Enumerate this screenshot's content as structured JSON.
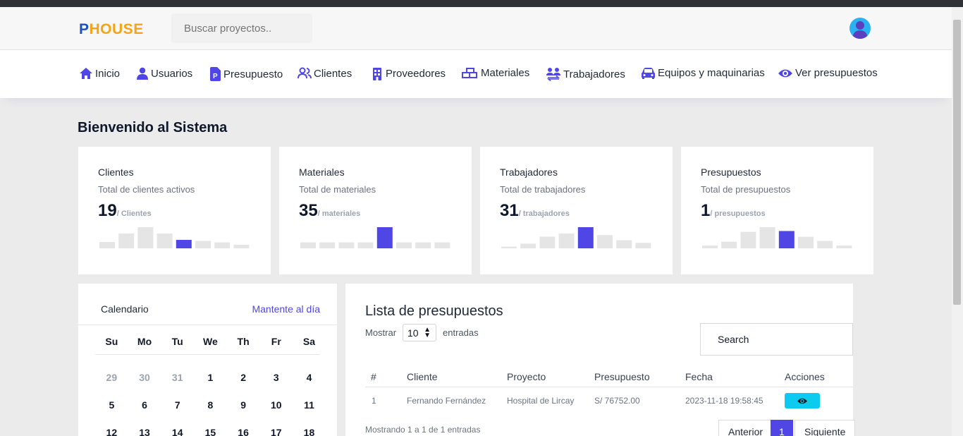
{
  "header": {
    "logo_first": "P",
    "logo_rest": "HOUSE",
    "search_placeholder": "Buscar proyectos.."
  },
  "nav": {
    "items": [
      {
        "label": "Inicio",
        "icon": "home-icon"
      },
      {
        "label": "Usuarios",
        "icon": "user-icon"
      },
      {
        "label": "Presupuesto",
        "icon": "budget-icon"
      },
      {
        "label": "Clientes",
        "icon": "users-icon"
      },
      {
        "label": "Proveedores",
        "icon": "building-icon"
      },
      {
        "label": "Materiales",
        "icon": "materials-icon"
      },
      {
        "label": "Trabajadores",
        "icon": "workers-icon"
      },
      {
        "label": "Equipos y maquinarias",
        "icon": "car-icon"
      },
      {
        "label": "Ver presupuestos",
        "icon": "eye-icon"
      }
    ]
  },
  "welcome": "Bienvenido al Sistema",
  "colors": {
    "accent": "#4f46e5",
    "logo_p": "#1e4fc1",
    "logo_rest": "#f5a417",
    "action": "#0dcaf0"
  },
  "stats": [
    {
      "title": "Clientes",
      "subtitle": "Total de clientes activos",
      "value": "19",
      "unit": "/ Clientes",
      "bars": [
        3,
        7,
        10,
        7,
        4,
        3.5,
        2.8,
        1.7
      ],
      "highlight": 4
    },
    {
      "title": "Materiales",
      "subtitle": "Total de materiales",
      "value": "35",
      "unit": "/ materiales",
      "bars": [
        2.8,
        2.8,
        2.8,
        2.8,
        10,
        2.8,
        2.8,
        2.8
      ],
      "highlight": 4
    },
    {
      "title": "Trabajadores",
      "subtitle": "Total de trabajadores",
      "value": "31",
      "unit": "/ trabajadores",
      "bars": [
        1,
        2.7,
        6.8,
        8.6,
        12.3,
        7.7,
        4.7,
        3.2
      ],
      "highlight": 4
    },
    {
      "title": "Presupuestos",
      "subtitle": "Total de presupuestos",
      "value": "1",
      "unit": "/ presupuestos",
      "bars": [
        1,
        2.4,
        6,
        7.7,
        6.3,
        4.2,
        2.7,
        1
      ],
      "highlight": 4
    }
  ],
  "calendar": {
    "title": "Calendario",
    "link": "Mantente al día",
    "weekdays": [
      "Su",
      "Mo",
      "Tu",
      "We",
      "Th",
      "Fr",
      "Sa"
    ],
    "weeks": [
      [
        "29",
        "30",
        "31",
        "1",
        "2",
        "3",
        "4"
      ],
      [
        "5",
        "6",
        "7",
        "8",
        "9",
        "10",
        "11"
      ],
      [
        "12",
        "13",
        "14",
        "15",
        "16",
        "17",
        "18"
      ]
    ],
    "muted_first_week": 3
  },
  "budgets": {
    "title": "Lista de presupuestos",
    "show_label": "Mostrar",
    "page_size": "10",
    "entries_label": "entradas",
    "search_placeholder": "Search",
    "columns": [
      "#",
      "Cliente",
      "Proyecto",
      "Presupuesto",
      "Fecha",
      "Acciones"
    ],
    "rows": [
      {
        "num": "1",
        "client": "Fernando Fernández",
        "project": "Hospital de Lircay",
        "amount": "S/ 76752.00",
        "date": "2023-11-18 19:58:45"
      }
    ],
    "showing": "Mostrando 1 a 1 de 1 entradas",
    "prev": "Anterior",
    "page": "1",
    "next": "Siguiente"
  }
}
